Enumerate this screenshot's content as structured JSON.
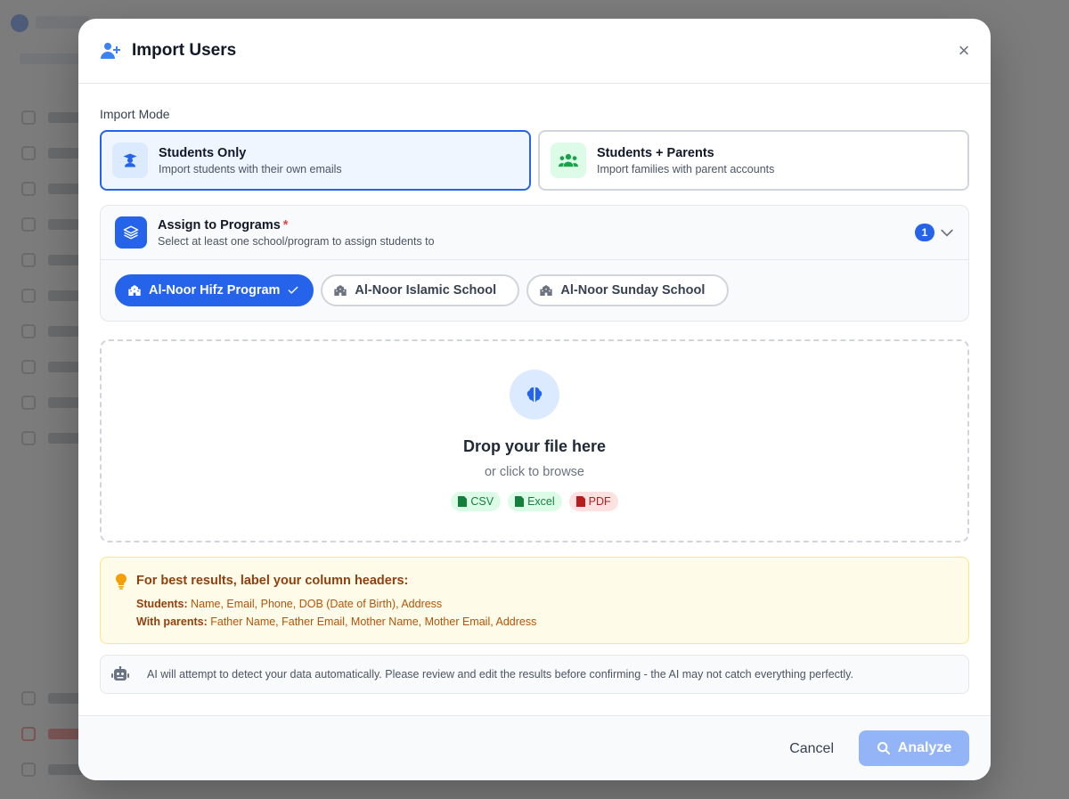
{
  "modal": {
    "title": "Import Users",
    "close_label": "×"
  },
  "import_mode": {
    "label": "Import Mode",
    "options": [
      {
        "title": "Students Only",
        "description": "Import students with their own emails",
        "selected": true,
        "icon": "graduate-icon"
      },
      {
        "title": "Students + Parents",
        "description": "Import families with parent accounts",
        "selected": false,
        "icon": "users-icon"
      }
    ]
  },
  "programs": {
    "title": "Assign to Programs",
    "required_mark": "*",
    "description": "Select at least one school/program to assign students to",
    "selected_count": "1",
    "items": [
      {
        "label": "Al-Noor Hifz Program",
        "selected": true
      },
      {
        "label": "Al-Noor Islamic School",
        "selected": false
      },
      {
        "label": "Al-Noor Sunday School",
        "selected": false
      }
    ]
  },
  "dropzone": {
    "title": "Drop your file here",
    "subtitle": "or click to browse",
    "formats": [
      {
        "label": "CSV",
        "color": "green"
      },
      {
        "label": "Excel",
        "color": "green"
      },
      {
        "label": "PDF",
        "color": "red"
      }
    ]
  },
  "tips": {
    "title": "For best results, label your column headers:",
    "students_label": "Students:",
    "students_text": "Name, Email, Phone, DOB (Date of Birth), Address",
    "parents_label": "With parents:",
    "parents_text": "Father Name, Father Email, Mother Name, Mother Email, Address"
  },
  "ai_note": {
    "text": "AI will attempt to detect your data automatically. Please review and edit the results before confirming - the AI may not catch everything perfectly."
  },
  "footer": {
    "cancel_label": "Cancel",
    "analyze_label": "Analyze"
  },
  "colors": {
    "primary": "#2563eb",
    "analyze_disabled": "#93b4f7",
    "tip_bg": "#fefce8",
    "tip_text": "#92400e"
  }
}
